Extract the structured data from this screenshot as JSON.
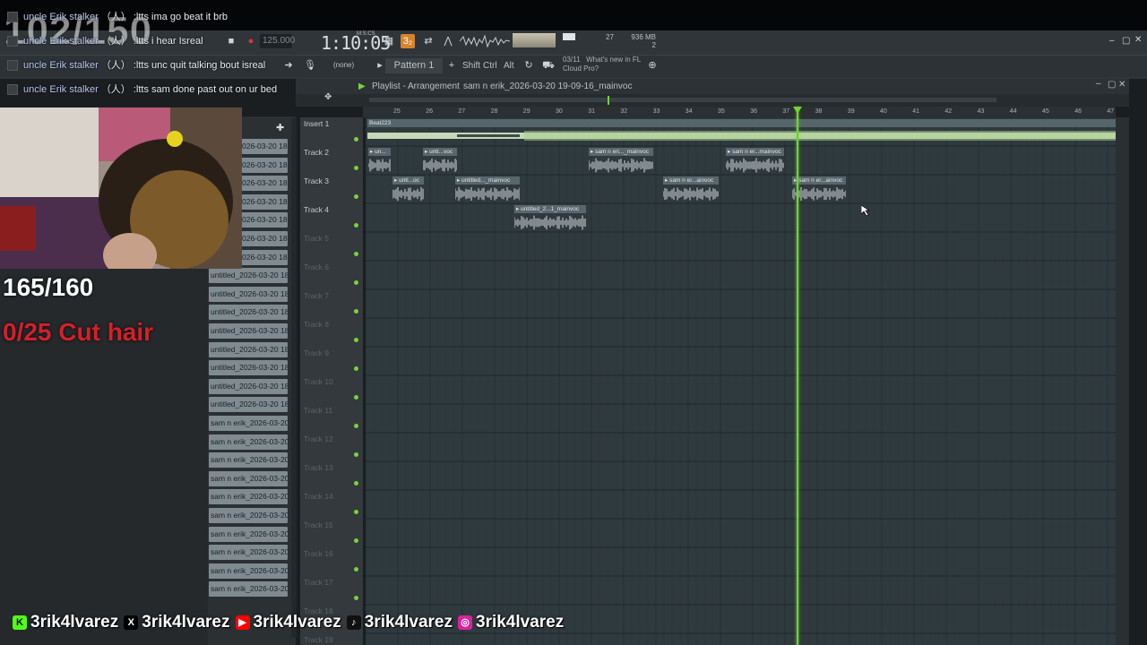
{
  "chat": [
    {
      "user": "uncle Erik stalker",
      "badge": "（人）",
      "message": ":ltts ima go beat it brb"
    },
    {
      "user": "uncle Erik stalker",
      "badge": "（人）",
      "message": ":ltts i hear Isreal"
    },
    {
      "user": "uncle Erik stalker",
      "badge": "（人）",
      "message": ":ltts unc quit talking bout isreal"
    },
    {
      "user": "uncle Erik stalker",
      "badge": "（人）",
      "message": ":ltts sam done past out on ur bed"
    }
  ],
  "overlay": {
    "goal_counter": "102/150",
    "counter_white": "165/160",
    "counter_red": "0/25 Cut hair"
  },
  "toolbar": {
    "bpm": "125.000",
    "time": "1:10:05",
    "time_unit": "M:S:CS",
    "pattern": "Pattern 1",
    "none_select": "(none)",
    "shift": "Shift",
    "ctrl": "Ctrl",
    "alt": "Alt",
    "cpu_value": "27",
    "memory": "936 MB",
    "voices": "2",
    "news_date": "03/11",
    "news_text": "What's new in FL",
    "news_text2": "Cloud Pro?",
    "accent_color": "#d6842c"
  },
  "playlist": {
    "title": "Playlist - Arrangement",
    "arrangement": "sam n erik_2026-03-20 19-09-16_mainvoc",
    "ruler": [
      "25",
      "26",
      "27",
      "28",
      "29",
      "30",
      "31",
      "32",
      "33",
      "34",
      "35",
      "36",
      "37",
      "38",
      "39",
      "40",
      "41",
      "42",
      "43",
      "44",
      "45",
      "46",
      "47"
    ],
    "tracks": [
      "Insert 1",
      "Track 2",
      "Track 3",
      "Track 4",
      "Track 5",
      "Track 6",
      "Track 7",
      "Track 8",
      "Track 9",
      "Track 10",
      "Track 11",
      "Track 12",
      "Track 13",
      "Track 14",
      "Track 15",
      "Track 16",
      "Track 17",
      "Track 18",
      "Track 19"
    ],
    "beat_clip": "Beat223",
    "clips": [
      {
        "label": "un..."
      },
      {
        "label": "unti...voc"
      },
      {
        "label": "sam n eri..._mainvoc"
      },
      {
        "label": "sam n er...mainvoc"
      },
      {
        "label": "unti...oc"
      },
      {
        "label": "untitled..._mainvoc"
      },
      {
        "label": "sam n er...ainvoc"
      },
      {
        "label": "sam n er...ainvoc"
      },
      {
        "label": "untitled_2...1_mainvoc"
      }
    ],
    "accent_green": "#6fd433"
  },
  "browser": {
    "items": [
      "026-03-20 18-...",
      "026-03-20 18-...",
      "026-03-20 18-...",
      "026-03-20 18-...",
      "026-03-20 18-...",
      "026-03-20 18-...",
      "026-03-20 18-...",
      "untitled_2026-03-20 18-...",
      "untitled_2026-03-20 18-...",
      "untitled_2026-03-20 18-...",
      "untitled_2026-03-20 18-...",
      "untitled_2026-03-20 18-...",
      "untitled_2026-03-20 18-...",
      "untitled_2026-03-20 18-...",
      "untitled_2026-03-20 18-...",
      "sam n erik_2026-03-20...",
      "sam n erik_2026-03-20...",
      "sam n erik_2026-03-20...",
      "sam n erik_2026-03-20...",
      "sam n erik_2026-03-20...",
      "sam n erik_2026-03-20...",
      "sam n erik_2026-03-20...",
      "sam n erik_2026-03-20...",
      "sam n erik_2026-03-20...",
      "sam n erik_2026-03-20..."
    ]
  },
  "socials": [
    {
      "icon": "kick-icon",
      "glyph": "K",
      "handle": "3rik4lvarez",
      "color": "#53fc18"
    },
    {
      "icon": "x-icon",
      "glyph": "X",
      "handle": "3rik4lvarez",
      "color": "#000000"
    },
    {
      "icon": "youtube-icon",
      "glyph": "▶",
      "handle": "3rik4lvarez",
      "color": "#ff0000"
    },
    {
      "icon": "tiktok-icon",
      "glyph": "♪",
      "handle": "3rik4lvarez",
      "color": "#111111"
    },
    {
      "icon": "instagram-icon",
      "glyph": "◎",
      "handle": "3rik4lvarez",
      "color": "#d6249f"
    }
  ]
}
